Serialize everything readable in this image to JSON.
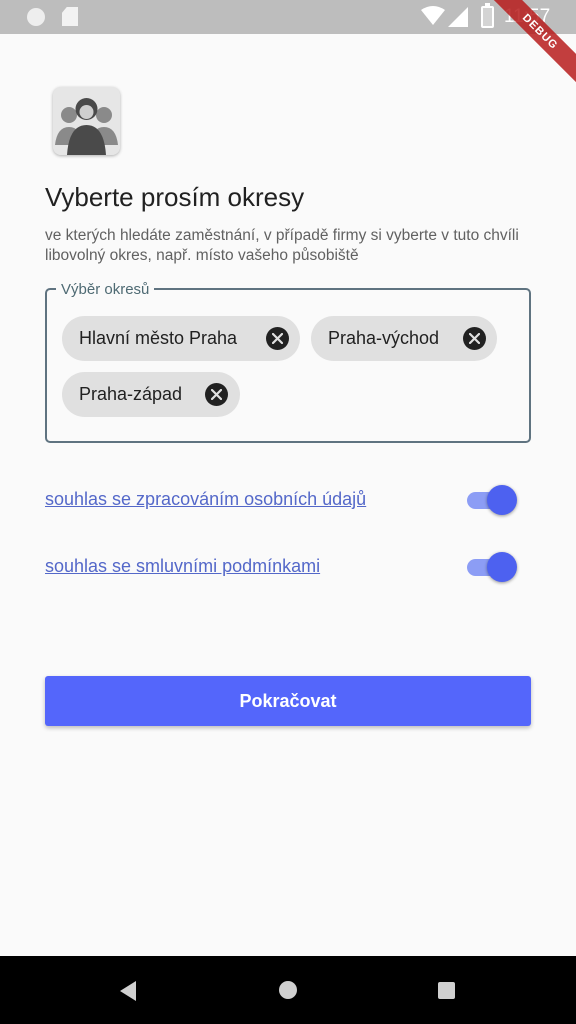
{
  "status_bar": {
    "time": "11:57",
    "icons": [
      "circle-icon",
      "sd-card-icon",
      "wifi-icon",
      "signal-icon",
      "battery-charging-icon"
    ]
  },
  "debug_banner": "DEBUG",
  "header": {
    "title": "Vyberte prosím okresy",
    "description": "ve kterých hledáte zaměstnání, v případě firmy si vyberte v tuto chvíli libovolný okres, např. místo vašeho působiště"
  },
  "district_selection": {
    "label": "Výběr okresů",
    "chips": [
      {
        "label": "Hlavní město Praha"
      },
      {
        "label": "Praha-východ"
      },
      {
        "label": "Praha-západ"
      }
    ]
  },
  "consents": [
    {
      "label": "souhlas se zpracováním osobních údajů",
      "enabled": true
    },
    {
      "label": "souhlas se smluvními podmínkami",
      "enabled": true
    }
  ],
  "primary_button": {
    "label": "Pokračovat"
  },
  "colors": {
    "accent": "#5466fb",
    "switch_thumb": "#4d61f0",
    "switch_track": "#8c9df5",
    "link": "#5468c9",
    "chip_bg": "#e0e0e0",
    "border": "#5f7380"
  }
}
